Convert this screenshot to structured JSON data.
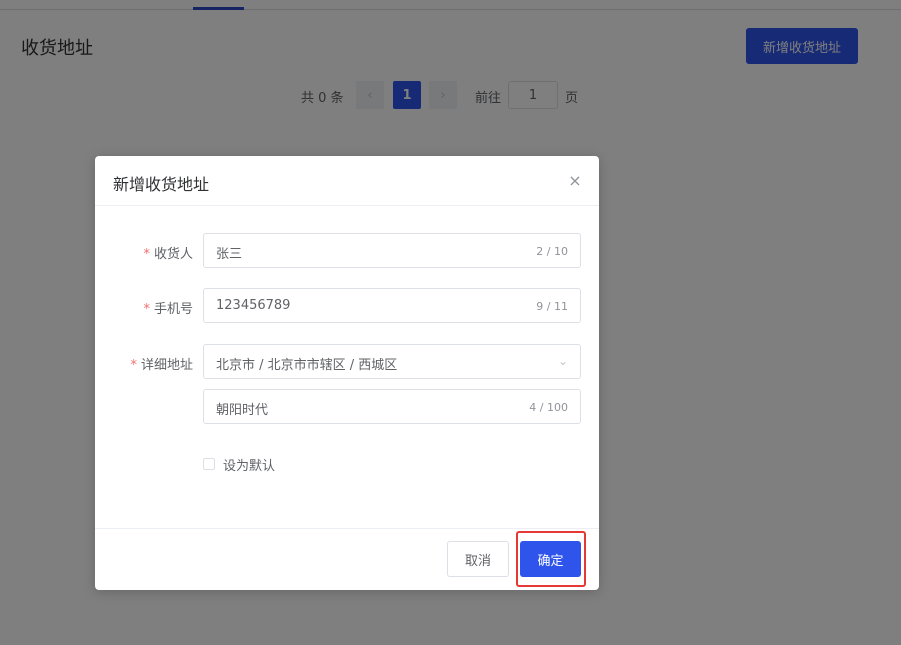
{
  "page": {
    "title": "收货地址",
    "add_button": "新增收货地址",
    "pagination": {
      "total": "共 0 条",
      "prev_icon": "‹",
      "current_page": "1",
      "next_icon": "›",
      "goto_label": "前往",
      "goto_value": "1",
      "page_label": "页"
    }
  },
  "dialog": {
    "title": "新增收货地址",
    "close_icon": "×",
    "fields": {
      "consignee": {
        "label": "收货人",
        "value": "张三",
        "count": "2 / 10"
      },
      "phone": {
        "label": "手机号",
        "value": "123456789",
        "count": "9 / 11"
      },
      "address": {
        "label": "详细地址",
        "region": "北京市 / 北京市市辖区 / 西城区",
        "chevron_icon": "⌄",
        "detail": "朝阳时代",
        "count": "4 / 100"
      }
    },
    "required_mark": "*",
    "default_checkbox": {
      "label": "设为默认",
      "checked": false
    },
    "cancel_button": "取消",
    "confirm_button": "确定"
  },
  "colors": {
    "primary": "#2f54eb",
    "required": "#f56c6c",
    "highlight": "#e53935"
  }
}
